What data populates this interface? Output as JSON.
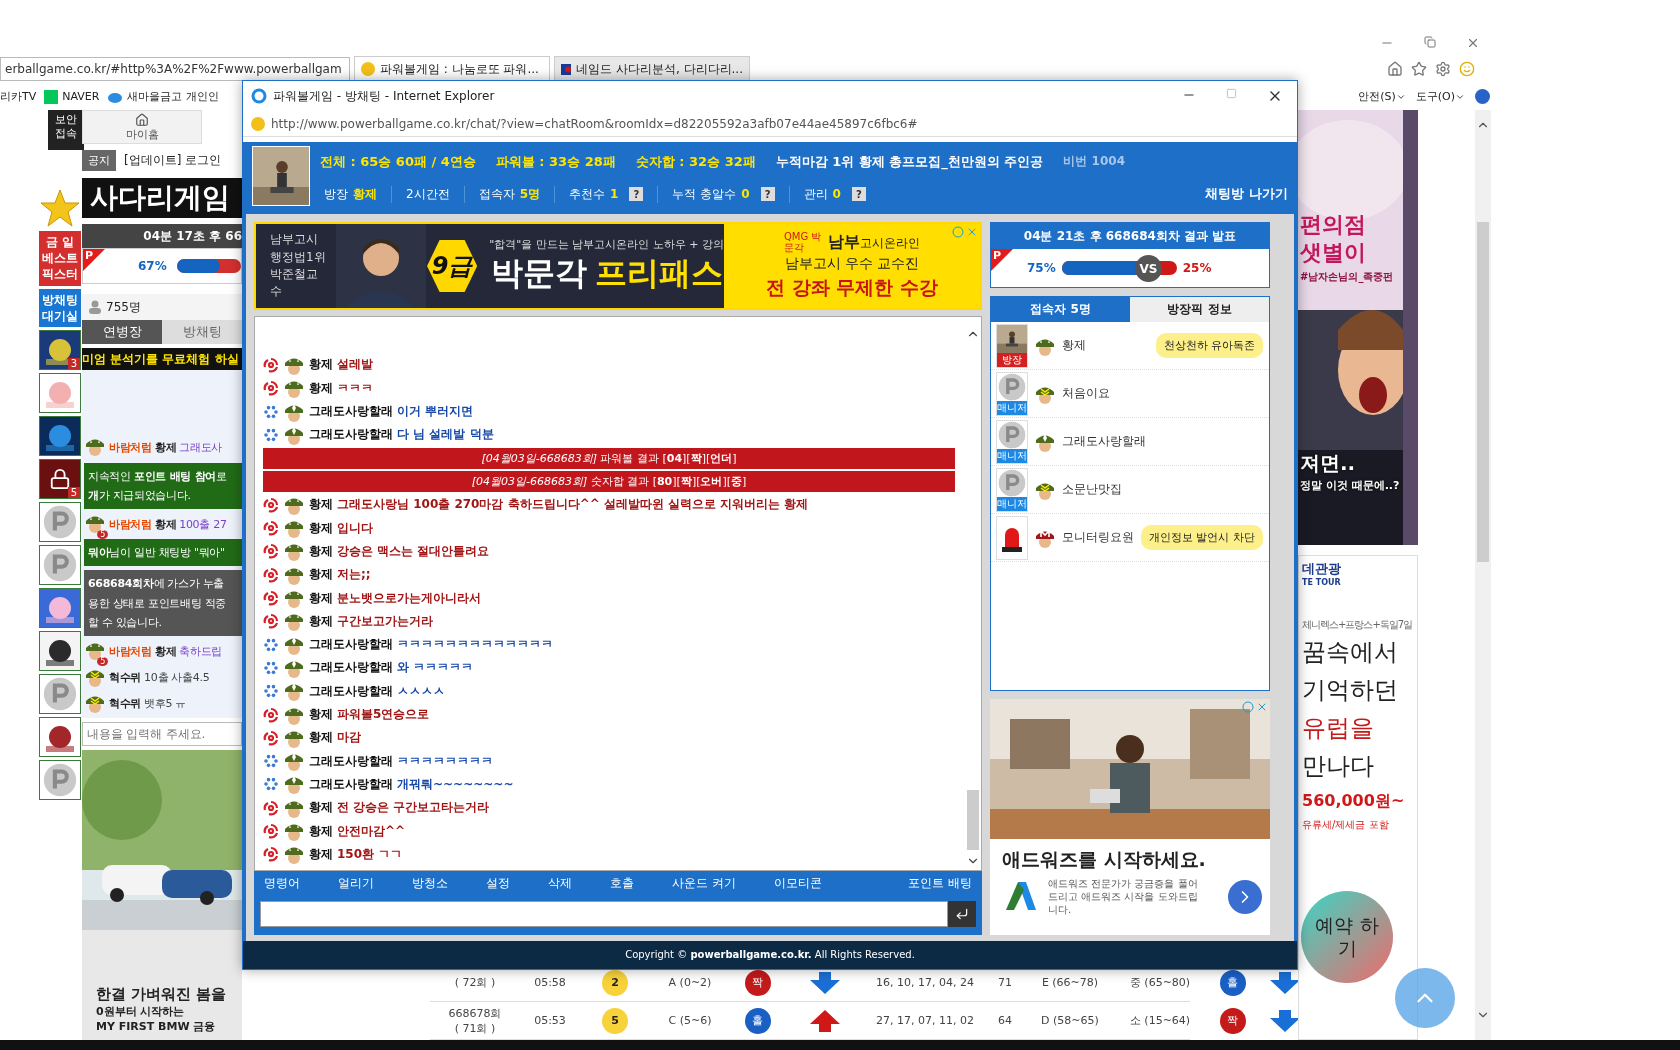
{
  "browser": {
    "address": "erballgame.co.kr/#http%3A%2F%2Fwww.powerballgam",
    "tabs": [
      {
        "label": "파워볼게임 : 나눔로또 파워...",
        "selected": true
      },
      {
        "label": "네임드 사다리분석, 다리다리...",
        "selected": false
      }
    ],
    "favorites": [
      {
        "label": "리카TV",
        "kind": "plain"
      },
      {
        "label": "NAVER",
        "kind": "naver"
      },
      {
        "label": "새마을금고 개인인",
        "kind": "cloud"
      }
    ],
    "menus": [
      "안전(S)",
      "도구(O)"
    ]
  },
  "page": {
    "security": "보안 접속",
    "home": "마이홈",
    "notice_label": "공지",
    "notice": "[업데이트] 로그인",
    "logo": "사다리게임",
    "timer": "04분 17초 후 66",
    "p_mark": "P",
    "left_bar": {
      "pct": "67%",
      "level": 0.67
    },
    "side_links": [
      {
        "label": "금 일 베스트 픽스터",
        "kind": "best"
      },
      {
        "label": "방채팅 대기실",
        "kind": "room"
      }
    ],
    "avatars": [
      {
        "kind": "night",
        "badge": "3"
      },
      {
        "kind": "peach"
      },
      {
        "kind": "sign"
      },
      {
        "kind": "lock",
        "badge": "5"
      },
      {
        "kind": "coin"
      },
      {
        "kind": "coin"
      },
      {
        "kind": "pig"
      },
      {
        "kind": "girl"
      },
      {
        "kind": "coin"
      },
      {
        "kind": "crest"
      },
      {
        "kind": "coin"
      }
    ],
    "users_count": "755명",
    "tabs": [
      {
        "label": "연병장",
        "selected": true
      },
      {
        "label": "방채팅",
        "selected": false
      }
    ],
    "marquee": "미엄 분석기를 무료체험 하실",
    "chat": [
      {
        "kind": "user",
        "name": "바람처럼",
        "to": "황제",
        "text": "그래도사"
      },
      {
        "kind": "green_notice",
        "lines": [
          "지속적인 **포인트 배팅 참여**로",
          "**개**가 지급되었습니다."
        ]
      },
      {
        "kind": "user",
        "name": "바람처럼",
        "to": "황제",
        "text": "100출 27",
        "badge": "5"
      },
      {
        "kind": "green_notice",
        "lines": [
          "**뭐아**님이 일반 채팅방 \"뭐아\""
        ]
      },
      {
        "kind": "grey_notice",
        "lines": [
          "**668684회차**에 가스가 누출",
          "용한 상태로 포인트배팅 적중",
          "할 수 있습니다."
        ]
      },
      {
        "kind": "user",
        "name": "바람처럼",
        "to": "황제",
        "text": "축하드립",
        "badge": "5"
      },
      {
        "kind": "plain",
        "name": "혁수뮈",
        "text": "10출 사출4.5"
      },
      {
        "kind": "plain",
        "name": "혁수뮈",
        "text": "뱃후5 ㅠ"
      }
    ],
    "input_placeholder": "내용을 입력해 주세요.",
    "ad": {
      "headline": "한결 가벼워진 봄을",
      "sub1": "0원부터 시작하는",
      "sub2": "MY FIRST BMW 금융"
    },
    "results": [
      {
        "sub": "( 72회 )",
        "time": "05:58",
        "ball": "2",
        "range": "A (0~2)",
        "parity": {
          "text": "짝",
          "color": "#c41a1a"
        },
        "arrow": {
          "kind": "down"
        },
        "numbers": "16, 10, 17, 04, 24",
        "sum": "71",
        "sum_range": "E (66~78)",
        "size": "중 (65~80)",
        "sum_parity": {
          "text": "홀",
          "color": "#1a5fc4"
        },
        "sum_arrow": {
          "kind": "down"
        }
      },
      {
        "round": "668678회",
        "sub": "( 71회 )",
        "time": "05:53",
        "ball": "5",
        "range": "C (5~6)",
        "parity": {
          "text": "홀",
          "color": "#1a5fc4"
        },
        "arrow": {
          "kind": "up"
        },
        "numbers": "27, 17, 07, 11, 02",
        "sum": "64",
        "sum_range": "D (58~65)",
        "size": "소 (15~64)",
        "sum_parity": {
          "text": "짝",
          "color": "#c41a1a"
        },
        "sum_arrow": {
          "kind": "down"
        }
      }
    ],
    "webtoon": {
      "title1": "편의점",
      "title2": "샛별이",
      "tag": "#남자손님의_족중펀",
      "line1": "져면..",
      "line2": "정말 이것 때문에..?"
    },
    "tour": {
      "brand": "데관광",
      "brand_en": "TE TOUR",
      "route": "체니렉스+프랑스+독일7일",
      "lines": [
        "꿈속에서",
        "기억하던",
        "유럽을",
        "만나다"
      ],
      "price": "560,000원~",
      "note": "유류세/제세금 포함",
      "cta": "예약 하기"
    }
  },
  "popup": {
    "title": "파워볼게임 - 방채팅 - Internet Explorer",
    "url": "http://www.powerballgame.co.kr/chat/?view=chatRoom&roomIdx=d82205592a3afb07e44ae45897c6fbc6#",
    "stats": [
      {
        "text": "전체 : 65승 60패 / 4연승",
        "kind": "stat"
      },
      {
        "text": "파워볼 : 33승 28패",
        "kind": "stat"
      },
      {
        "text": "숫자합 : 32승 32패",
        "kind": "stat"
      },
      {
        "text": "누적마감 1위 황제 총프모집_천만원의 주인공",
        "kind": "title"
      },
      {
        "text": "비번 1004",
        "kind": "dim"
      }
    ],
    "info": [
      {
        "label": "방장",
        "value": "황제",
        "help": false
      },
      {
        "label": "2시간전",
        "help": false
      },
      {
        "label": "접속자",
        "value": "5명",
        "help": false
      },
      {
        "label": "추천수",
        "value": "1",
        "help": true
      },
      {
        "label": "누적 충알수",
        "value": "0",
        "help": true
      },
      {
        "label": "관리",
        "value": "0",
        "help": true
      }
    ],
    "help_mark": "?",
    "leave": "채팅방 나가기",
    "banner": {
      "left": [
        "남부고시",
        "행정법1위",
        "박준철교수"
      ],
      "grade": "9급",
      "tagline": "\"합격\"을 만드는 남부고시온라인 노하우 + 강의",
      "brand": "박문각",
      "product": "프리패스",
      "right_brand": "남부",
      "right_brand_rest": "고시온라인",
      "right_small": "QMG 박문각",
      "right_line": "남부고시 우수 교수진",
      "right_cta": "전 강좌 무제한 수강"
    },
    "messages": [
      {
        "kind": "swirl",
        "name": "황제",
        "text": "설레발",
        "color": "#a01414"
      },
      {
        "kind": "swirl",
        "name": "황제",
        "text": "ㅋㅋㅋ",
        "color": "#a01414"
      },
      {
        "kind": "sparkle",
        "name": "그래도사랑할래",
        "text": "이거 뿌러지면",
        "color": "#1648a8"
      },
      {
        "kind": "sparkle",
        "name": "그래도사랑할래",
        "text": "다 님 설레발 덕분",
        "color": "#1648a8"
      },
      {
        "kind": "result",
        "text": "*[04월03일-668683회]* 파워볼 결과 [**04**][**짝**][**언더**]"
      },
      {
        "kind": "result",
        "text": "*[04월03일-668683회]* 숫자합 결과 [**80**][**짝**][**오버**][**중**]"
      },
      {
        "kind": "swirl",
        "name": "황제",
        "text": "그래도사랑님 100출 270마감 축하드립니다^^ 설레발따윈 실력으로 지워버리는 황제",
        "color": "#a01414"
      },
      {
        "kind": "swirl",
        "name": "황제",
        "text": "입니다",
        "color": "#a01414"
      },
      {
        "kind": "swirl",
        "name": "황제",
        "text": "강승은 맥스는 절대안틀려요",
        "color": "#a01414"
      },
      {
        "kind": "swirl",
        "name": "황제",
        "text": "저는;;",
        "color": "#a01414"
      },
      {
        "kind": "swirl",
        "name": "황제",
        "text": "분노뱃으로가는게아니라서",
        "color": "#a01414"
      },
      {
        "kind": "swirl",
        "name": "황제",
        "text": "구간보고가는거라",
        "color": "#a01414"
      },
      {
        "kind": "sparkle",
        "name": "그래도사랑할래",
        "text": "ㅋㅋㅋㅋㅋㅋㅋㅋㅋㅋㅋㅋㅋ",
        "color": "#1648a8"
      },
      {
        "kind": "sparkle",
        "name": "그래도사랑할래",
        "text": "와 ㅋㅋㅋㅋㅋ",
        "color": "#1648a8"
      },
      {
        "kind": "sparkle",
        "name": "그래도사랑할래",
        "text": "ㅅㅅㅅㅅ",
        "color": "#1648a8"
      },
      {
        "kind": "swirl",
        "name": "황제",
        "text": "파워볼5연승으로",
        "color": "#a01414"
      },
      {
        "kind": "swirl",
        "name": "황제",
        "text": "마감",
        "color": "#a01414"
      },
      {
        "kind": "sparkle",
        "name": "그래도사랑할래",
        "text": "ㅋㅋㅋㅋㅋㅋㅋㅋ",
        "color": "#1648a8"
      },
      {
        "kind": "sparkle",
        "name": "그래도사랑할래",
        "text": "개꿔뤄~~~~~~~~",
        "color": "#1648a8"
      },
      {
        "kind": "swirl",
        "name": "황제",
        "text": "전 강승은 구간보고타는거라",
        "color": "#a01414"
      },
      {
        "kind": "swirl",
        "name": "황제",
        "text": "안전마감^^",
        "color": "#a01414"
      },
      {
        "kind": "swirl",
        "name": "황제",
        "text": "150환 ㄱㄱ",
        "color": "#a01414"
      }
    ],
    "tools": [
      "명령어",
      "얼리기",
      "방청소",
      "설정",
      "삭제",
      "호출",
      "사운드 켜기",
      "이모티콘"
    ],
    "point_bet": "포인트 배팅",
    "copyright": "Copyright © **powerballgame.co.kr.** All Rights Reserved.",
    "timer": "04분 21초 후 668684회차 결과 발표",
    "left_pct": "75%",
    "right_pct": "25%",
    "level": 0.75,
    "vs": "VS",
    "p_mark": "P",
    "tabs": [
      {
        "label": "접속자 **5**명",
        "selected": true
      },
      {
        "label": "방장픽 정보",
        "selected": false
      }
    ],
    "users": [
      {
        "role": {
          "text": "방장",
          "kind": "owner"
        },
        "rank": {
          "kind": "stars"
        },
        "name": "황제",
        "bubble": "천상천하 유아독존"
      },
      {
        "avatar": {
          "kind": "coin"
        },
        "role": {
          "text": "매니저",
          "kind": "manager"
        },
        "rank": {
          "kind": "chevron"
        },
        "name": "처음이요"
      },
      {
        "avatar": {
          "kind": "coin"
        },
        "role": {
          "text": "매니저",
          "kind": "manager"
        },
        "rank": {
          "kind": "diamond"
        },
        "name": "그래도사랑할래"
      },
      {
        "avatar": {
          "kind": "coin"
        },
        "role": {
          "text": "매니저",
          "kind": "manager"
        },
        "rank": {
          "kind": "chevron"
        },
        "name": "소문난맛집"
      },
      {
        "avatar": {
          "kind": "siren"
        },
        "rank": {
          "kind": "m"
        },
        "name": "모니터링요원",
        "bubble": "개인정보 발언시 차단"
      }
    ],
    "google_ad": {
      "headline": "애드워즈를 시작하세요.",
      "body": "애드워즈 전문가가 궁금증을 풀어드리고 애드워즈 시작을 도와드립니다."
    }
  }
}
